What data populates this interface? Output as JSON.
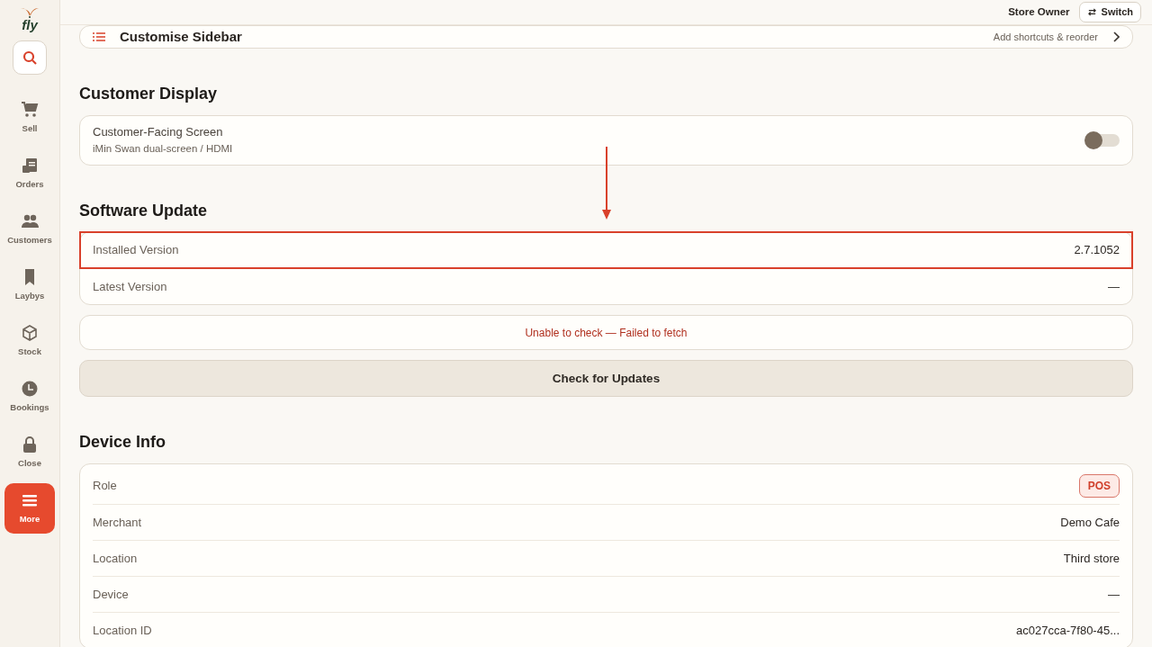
{
  "sidebar": {
    "logo": "fly",
    "items": [
      {
        "label": "Sell",
        "kind": "cart",
        "selected": false
      },
      {
        "label": "Orders",
        "kind": "receipt",
        "selected": false
      },
      {
        "label": "Customers",
        "kind": "people",
        "selected": false
      },
      {
        "label": "Laybys",
        "kind": "bookmark",
        "selected": false
      },
      {
        "label": "Stock",
        "kind": "box",
        "selected": false
      },
      {
        "label": "Bookings",
        "kind": "clock",
        "selected": false
      },
      {
        "label": "Close",
        "kind": "lock",
        "selected": false
      },
      {
        "label": "More",
        "kind": "menu",
        "selected": true
      }
    ]
  },
  "header": {
    "user": "Store Owner",
    "switch_button": "Switch"
  },
  "customise_sidebar": {
    "title": "Customise Sidebar",
    "hint": "Add shortcuts & reorder"
  },
  "sections": [
    {
      "title": "Customer Display",
      "kind": "toggle",
      "label": "Customer-Facing Screen",
      "description": "iMin Swan dual-screen / HDMI",
      "on": false
    },
    {
      "title": "Software Update",
      "kind": "update",
      "rows": [
        {
          "label": "Installed Version",
          "value": "2.7.1052",
          "highlighted": true
        },
        {
          "label": "Latest Version",
          "value": "—",
          "highlighted": false
        }
      ],
      "status": "Unable to check — Failed to fetch",
      "button": "Check for Updates"
    },
    {
      "title": "Device Info",
      "kind": "info",
      "rows": [
        {
          "label": "Role",
          "value": "POS",
          "kind": "badge"
        },
        {
          "label": "Merchant",
          "value": "Demo Cafe",
          "kind": "text"
        },
        {
          "label": "Location",
          "value": "Third store",
          "kind": "text"
        },
        {
          "label": "Device",
          "value": "—",
          "kind": "text"
        },
        {
          "label": "Location ID",
          "value": "ac027cca-7f80-45...",
          "kind": "text"
        }
      ]
    }
  ]
}
